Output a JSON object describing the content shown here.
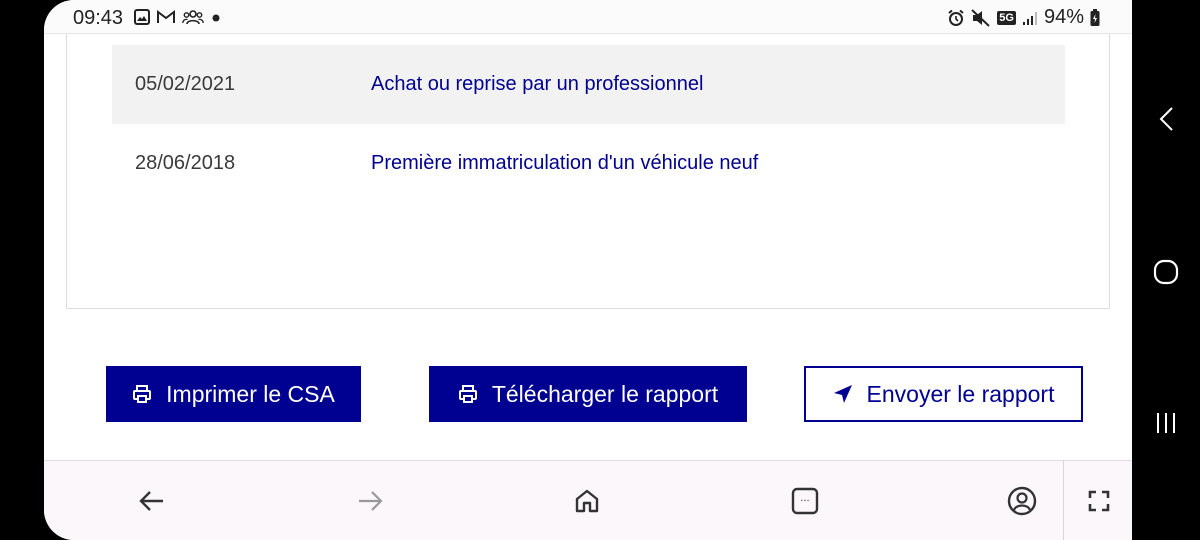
{
  "status_bar": {
    "time": "09:43",
    "notification_icons": [
      "gallery-icon",
      "gmail-icon",
      "group-icon",
      "dot-icon"
    ],
    "system_icons": [
      "alarm-icon",
      "mute-icon",
      "5g-icon",
      "signal-icon"
    ],
    "network_label": "5G",
    "battery": "94%"
  },
  "history": {
    "rows": [
      {
        "date": "05/02/2021",
        "event": "Achat ou reprise par un professionnel"
      },
      {
        "date": "28/06/2018",
        "event": "Première immatriculation d'un véhicule neuf"
      }
    ]
  },
  "actions": {
    "print_label": "Imprimer le CSA",
    "download_label": "Télécharger le rapport",
    "send_label": "Envoyer le rapport"
  },
  "browser_bar": {
    "tab_count": "..."
  },
  "colors": {
    "primary": "#000091",
    "row_shade": "#f2f2f2",
    "browser_bar_bg": "#fbf7fb"
  }
}
